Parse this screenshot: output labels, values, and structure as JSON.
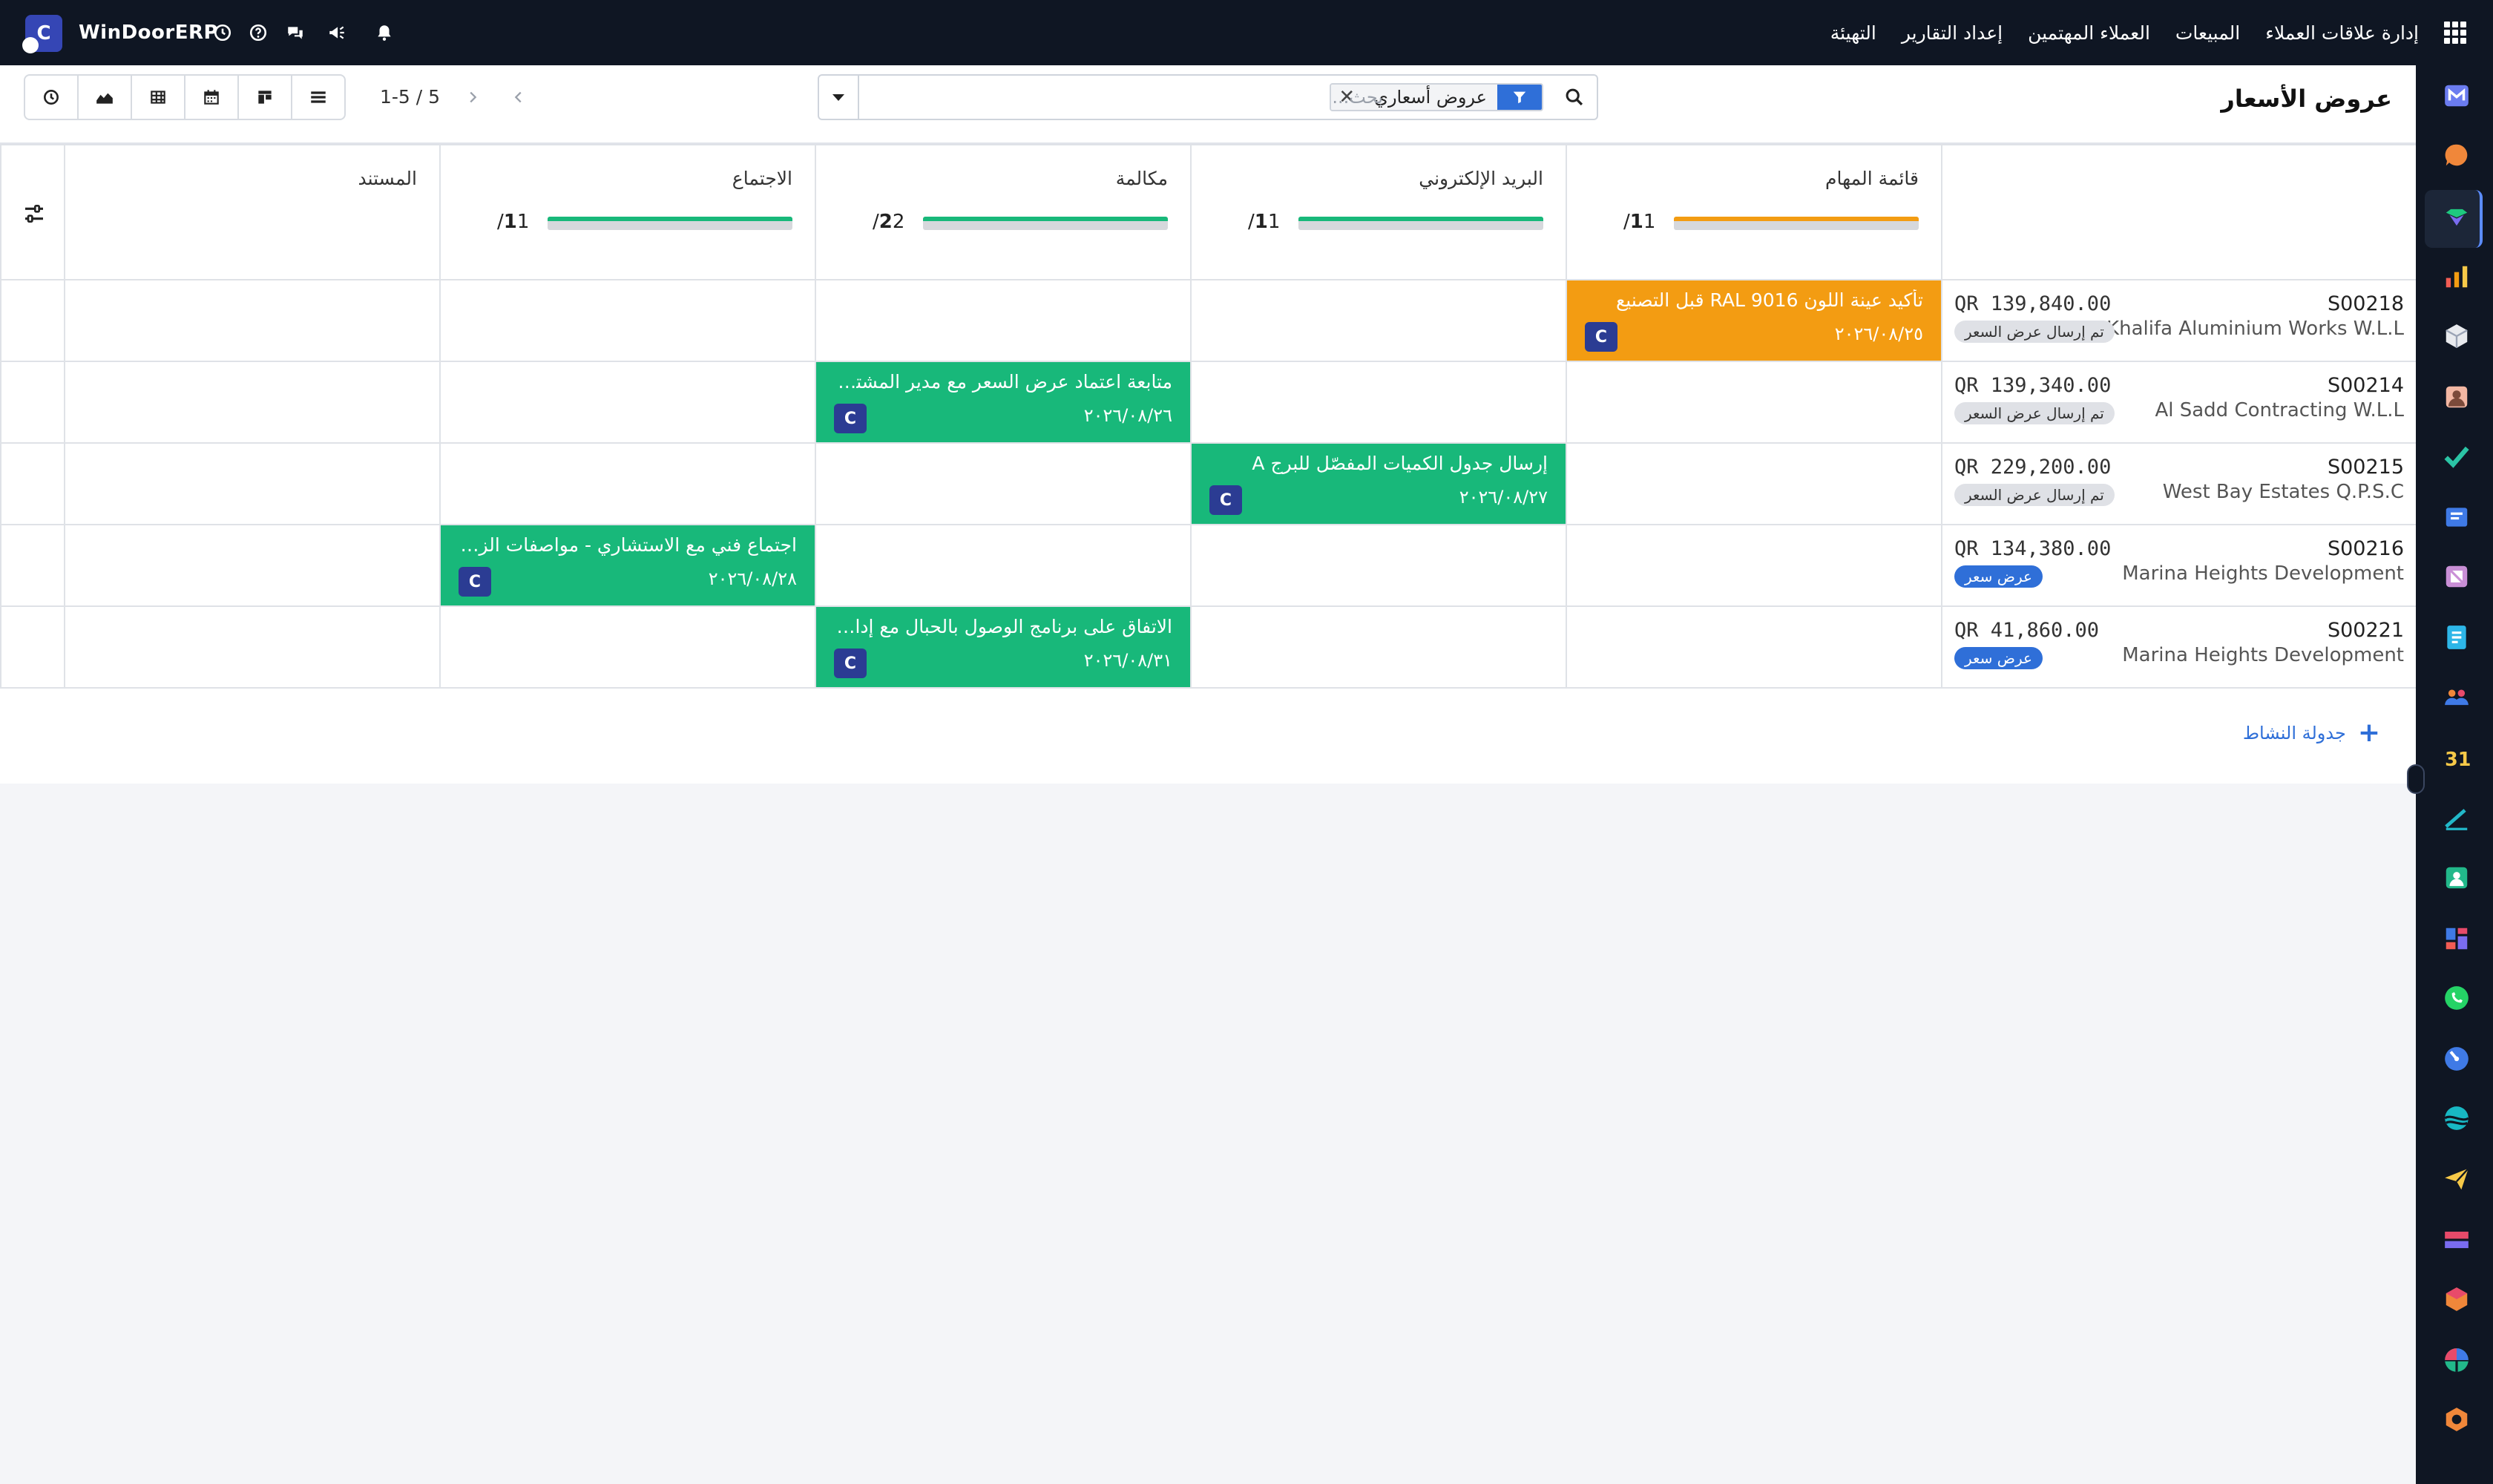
{
  "topbar": {
    "brand": "WinDoorERP",
    "logo_letter": "C",
    "menu": [
      "إدارة علاقات العملاء",
      "المبيعات",
      "العملاء المهتمين",
      "إعداد التقارير",
      "التهيئة"
    ]
  },
  "control": {
    "title": "عروض الأسعار",
    "facet": "عروض أسعاري",
    "search_placeholder": "بحث...",
    "pager": "1-5 / 5"
  },
  "columns": {
    "todo": {
      "title": "قائمة المهام",
      "count": "1",
      "total": "1/"
    },
    "email": {
      "title": "البريد الإلكتروني",
      "count": "1",
      "total": "1/"
    },
    "call": {
      "title": "مكالمة",
      "count": "2",
      "total": "2/"
    },
    "meeting": {
      "title": "الاجتماع",
      "count": "1",
      "total": "1/"
    },
    "document": {
      "title": "المستند"
    }
  },
  "records": [
    {
      "ref": "S00218",
      "partner": "Khalifa Aluminium Works W.L.L",
      "amount": "QR 139,840.00",
      "status": "تم إرسال عرض السعر"
    },
    {
      "ref": "S00214",
      "partner": "Al Sadd Contracting W.L.L",
      "amount": "QR 139,340.00",
      "status": "تم إرسال عرض السعر"
    },
    {
      "ref": "S00215",
      "partner": "West Bay Estates Q.P.S.C",
      "amount": "QR 229,200.00",
      "status": "تم إرسال عرض السعر"
    },
    {
      "ref": "S00216",
      "partner": "Marina Heights Development",
      "amount": "QR 134,380.00",
      "status": "عرض سعر"
    },
    {
      "ref": "S00221",
      "partner": "Marina Heights Development",
      "amount": "QR 41,860.00",
      "status": "عرض سعر"
    }
  ],
  "activities": {
    "a1": {
      "text": "تأكيد عينة اللون RAL 9016 قبل التصنيع",
      "date": "٢٠٢٦/٠٨/٢٥",
      "user": "C"
    },
    "a2": {
      "text": "متابعة اعتماد عرض السعر مع مدير المشتريات",
      "date": "٢٠٢٦/٠٨/٢٦",
      "user": "C"
    },
    "a3": {
      "text": "إرسال جدول الكميات المفصّل للبرج A",
      "date": "٢٠٢٦/٠٨/٢٧",
      "user": "C"
    },
    "a4": {
      "text": "اجتماع فني مع الاستشاري - مواصفات الزجا...",
      "date": "٢٠٢٦/٠٨/٢٨",
      "user": "C"
    },
    "a5": {
      "text": "الاتفاق على برنامج الوصول بالحبال مع إدارة ا...",
      "date": "٢٠٢٦/٠٨/٣١",
      "user": "C"
    }
  },
  "add_activity": "جدولة النشاط",
  "colors": {
    "topbar": "#0f1623",
    "overdue_orange": "#f39c12",
    "planned_green": "#18b87a",
    "accent_blue": "#2f6fd8"
  }
}
